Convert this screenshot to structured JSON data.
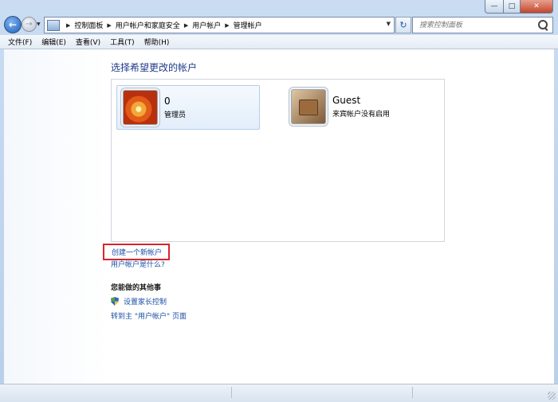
{
  "window": {
    "caption_buttons": {
      "minimize": "—",
      "maximize": "□",
      "close": "✕"
    }
  },
  "nav": {
    "back_icon": "back-arrow-icon",
    "forward_icon": "forward-arrow-icon",
    "breadcrumb": [
      "控制面板",
      "用户帐户和家庭安全",
      "用户帐户",
      "管理帐户"
    ],
    "search_placeholder": "搜索控制面板"
  },
  "menu": {
    "items": [
      "文件(F)",
      "编辑(E)",
      "查看(V)",
      "工具(T)",
      "帮助(H)"
    ]
  },
  "main": {
    "heading": "选择希望更改的帐户",
    "accounts": [
      {
        "name": "0",
        "role": "管理员",
        "picture": "orange-flower"
      },
      {
        "name": "Guest",
        "role": "来宾帐户没有启用",
        "picture": "suitcase"
      }
    ],
    "links": {
      "create_account": "创建一个新帐户",
      "what_is_account": "用户帐户是什么?"
    },
    "other_section": {
      "heading": "您能做的其他事",
      "parental_controls": "设置家长控制",
      "go_home": "转到主 \"用户帐户\" 页面"
    }
  },
  "colors": {
    "link": "#1a4fa3",
    "heading": "#1e3a8a",
    "highlight_border": "#d8262b"
  }
}
